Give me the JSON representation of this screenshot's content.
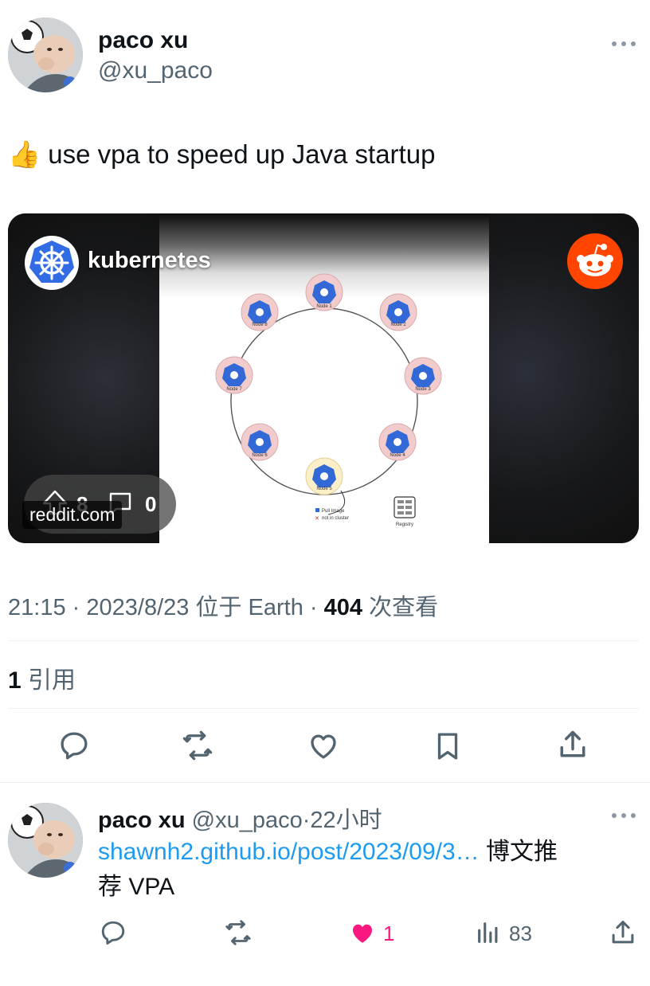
{
  "tweet": {
    "author_name": "paco xu",
    "author_handle": "@xu_paco",
    "more_icon": "more-horizontal-icon",
    "emoji": "👍",
    "text": "use vpa to speed up Java startup",
    "media": {
      "channel_name": "kubernetes",
      "channel_icon": "kubernetes-helm-icon",
      "platform_icon": "reddit-icon",
      "upvotes": "8",
      "comments": "0",
      "source": "reddit.com",
      "diagram": {
        "nodes": [
          "Node 1",
          "Node 2",
          "Node 3",
          "Node 4",
          "Node 5",
          "Node 6",
          "Node 7",
          "Node 8"
        ],
        "legend_pull": "Pull Image",
        "legend_not": "not in cluster",
        "registry": "Registry"
      }
    },
    "meta": {
      "time": "21:15",
      "sep1": "·",
      "date": "2023/8/23",
      "location": "位于 Earth",
      "sep2": "·",
      "views_count": "404",
      "views_label": "次查看"
    },
    "quotes": {
      "count": "1",
      "label": "引用"
    },
    "actions": [
      "reply-icon",
      "retweet-icon",
      "like-icon",
      "bookmark-icon",
      "share-icon"
    ]
  },
  "quote_tweet": {
    "author_name": "paco xu",
    "author_handle": "@xu_paco",
    "sep": "·",
    "time_ago": "22小时",
    "link": "shawnh2.github.io/post/2023/09/3…",
    "text_line1_suffix": " 博文推",
    "text_line2": "荐 VPA",
    "like_count": "1",
    "views_count": "83",
    "colors": {
      "like": "#f91880",
      "link": "#1d9bf0"
    }
  }
}
